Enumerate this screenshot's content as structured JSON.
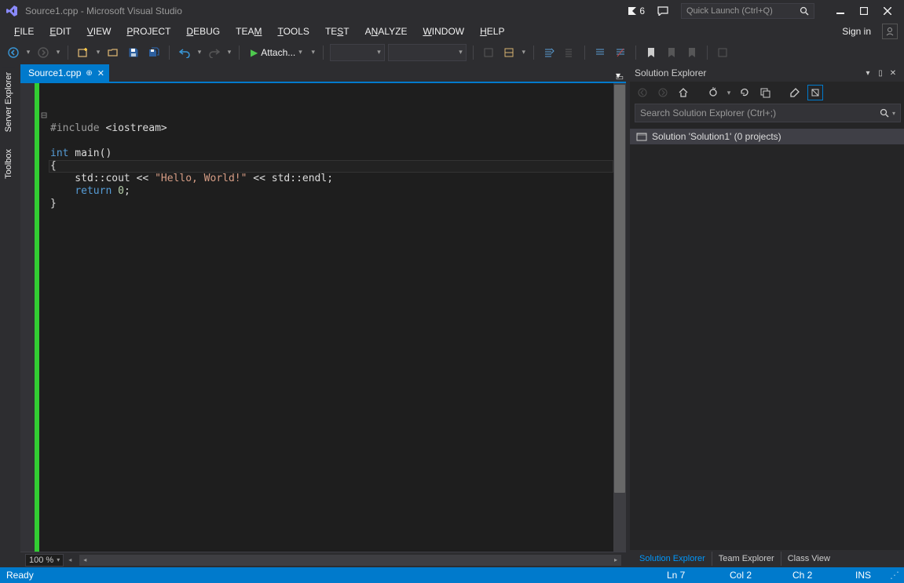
{
  "title": "Source1.cpp - Microsoft Visual Studio",
  "notifications_count": "6",
  "quick_launch_placeholder": "Quick Launch (Ctrl+Q)",
  "menus": {
    "file": "FILE",
    "edit": "EDIT",
    "view": "VIEW",
    "project": "PROJECT",
    "debug": "DEBUG",
    "team": "TEAM",
    "tools": "TOOLS",
    "test": "TEST",
    "analyze": "ANALYZE",
    "window": "WINDOW",
    "help": "HELP"
  },
  "signin": "Sign in",
  "toolbar": {
    "attach_label": "Attach...",
    "combo1": "",
    "combo2": ""
  },
  "doc_tab": {
    "name": "Source1.cpp"
  },
  "editor": {
    "zoom": "100 %",
    "code_lines": [
      {
        "t": "pp",
        "text": "#include "
      },
      {
        "t": "raw",
        "text": "<iostream>"
      },
      {
        "t": "nl"
      },
      {
        "t": "nl"
      },
      {
        "t": "kw",
        "text": "int"
      },
      {
        "t": "raw",
        "text": " main()"
      },
      {
        "t": "nl"
      },
      {
        "t": "raw",
        "text": "{"
      },
      {
        "t": "nl"
      },
      {
        "t": "raw",
        "text": "    std::cout << "
      },
      {
        "t": "str",
        "text": "\"Hello, World!\""
      },
      {
        "t": "raw",
        "text": " << std::endl;"
      },
      {
        "t": "nl"
      },
      {
        "t": "raw",
        "text": "    "
      },
      {
        "t": "kw",
        "text": "return"
      },
      {
        "t": "raw",
        "text": " "
      },
      {
        "t": "num",
        "text": "0"
      },
      {
        "t": "raw",
        "text": ";"
      },
      {
        "t": "nl"
      },
      {
        "t": "raw",
        "text": "}"
      }
    ]
  },
  "solution_explorer": {
    "title": "Solution Explorer",
    "search_placeholder": "Search Solution Explorer (Ctrl+;)",
    "root": "Solution 'Solution1' (0 projects)"
  },
  "bottom_tabs": {
    "solution": "Solution Explorer",
    "team": "Team Explorer",
    "class": "Class View"
  },
  "side_tabs": {
    "server": "Server Explorer",
    "toolbox": "Toolbox"
  },
  "status": {
    "ready": "Ready",
    "ln": "Ln 7",
    "col": "Col 2",
    "ch": "Ch 2",
    "ins": "INS"
  }
}
